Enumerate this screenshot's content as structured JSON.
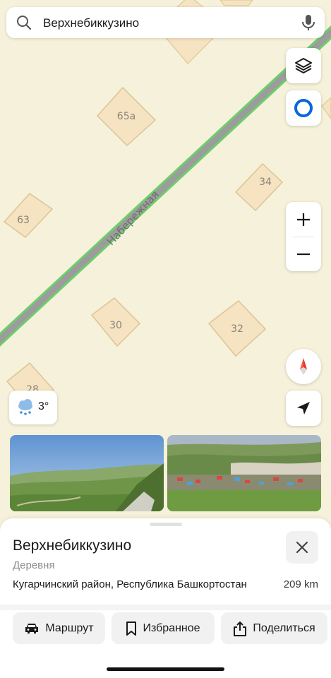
{
  "search": {
    "query": "Верхнебиккузино"
  },
  "map": {
    "street_name": "Набережная",
    "buildings": [
      {
        "id": "b-65a",
        "label": "65а"
      },
      {
        "id": "b-34",
        "label": "34"
      },
      {
        "id": "b-63",
        "label": "63"
      },
      {
        "id": "b-30",
        "label": "30"
      },
      {
        "id": "b-32",
        "label": "32"
      },
      {
        "id": "b-28",
        "label": "28"
      }
    ],
    "colors": {
      "land": "#f6f1da",
      "building": "#f5e3c1",
      "road": "#9c9c9c",
      "road_edge": "#6ccf6c",
      "accent": "#0a66dd"
    }
  },
  "weather": {
    "temperature": "3°",
    "icon": "snow-cloud-icon"
  },
  "photos": [
    {
      "name": "landscape-photo-1"
    },
    {
      "name": "village-photo-2"
    }
  ],
  "place": {
    "title": "Верхнебиккузино",
    "type": "Деревня",
    "address": "Кугарчинский район, Республика Башкортостан",
    "distance": "209 km"
  },
  "actions": {
    "route": "Маршрут",
    "favorite": "Избранное",
    "share": "Поделиться"
  }
}
